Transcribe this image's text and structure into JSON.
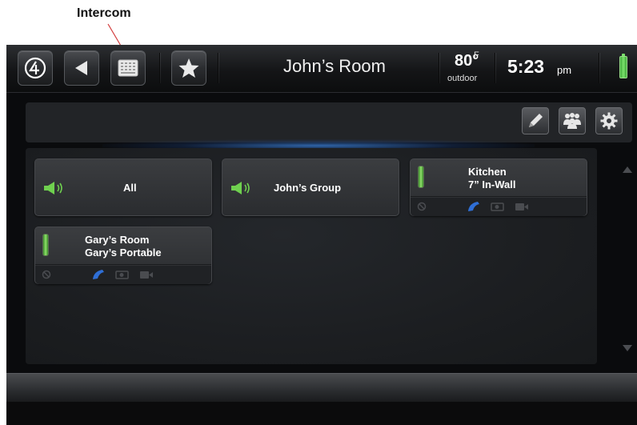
{
  "annotation": {
    "callout_label": "Intercom"
  },
  "topbar": {
    "room_title": "John’s Room",
    "temperature": "80°",
    "temperature_unit": "F",
    "temperature_label": "outdoor",
    "time": "5:23",
    "ampm": "pm",
    "buttons": [
      "control4-logo-icon",
      "back-arrow-icon",
      "intercom-keypad-icon",
      "favorites-star-icon"
    ]
  },
  "toolbar": {
    "icons": [
      "edit-pencil-icon",
      "group-users-icon",
      "settings-gear-icon"
    ]
  },
  "tiles": [
    {
      "label": "All",
      "type": "broadcast"
    },
    {
      "label": "John’s Group",
      "type": "broadcast"
    },
    {
      "line1": "Kitchen",
      "line2": "7” In-Wall",
      "type": "device"
    },
    {
      "line1": "Gary’s Room",
      "line2": "Gary’s Portable",
      "type": "device"
    }
  ],
  "colors": {
    "accent_glow": "#3c82dc",
    "status_green": "#7ae06b",
    "phone_blue": "#2f6fd6"
  }
}
